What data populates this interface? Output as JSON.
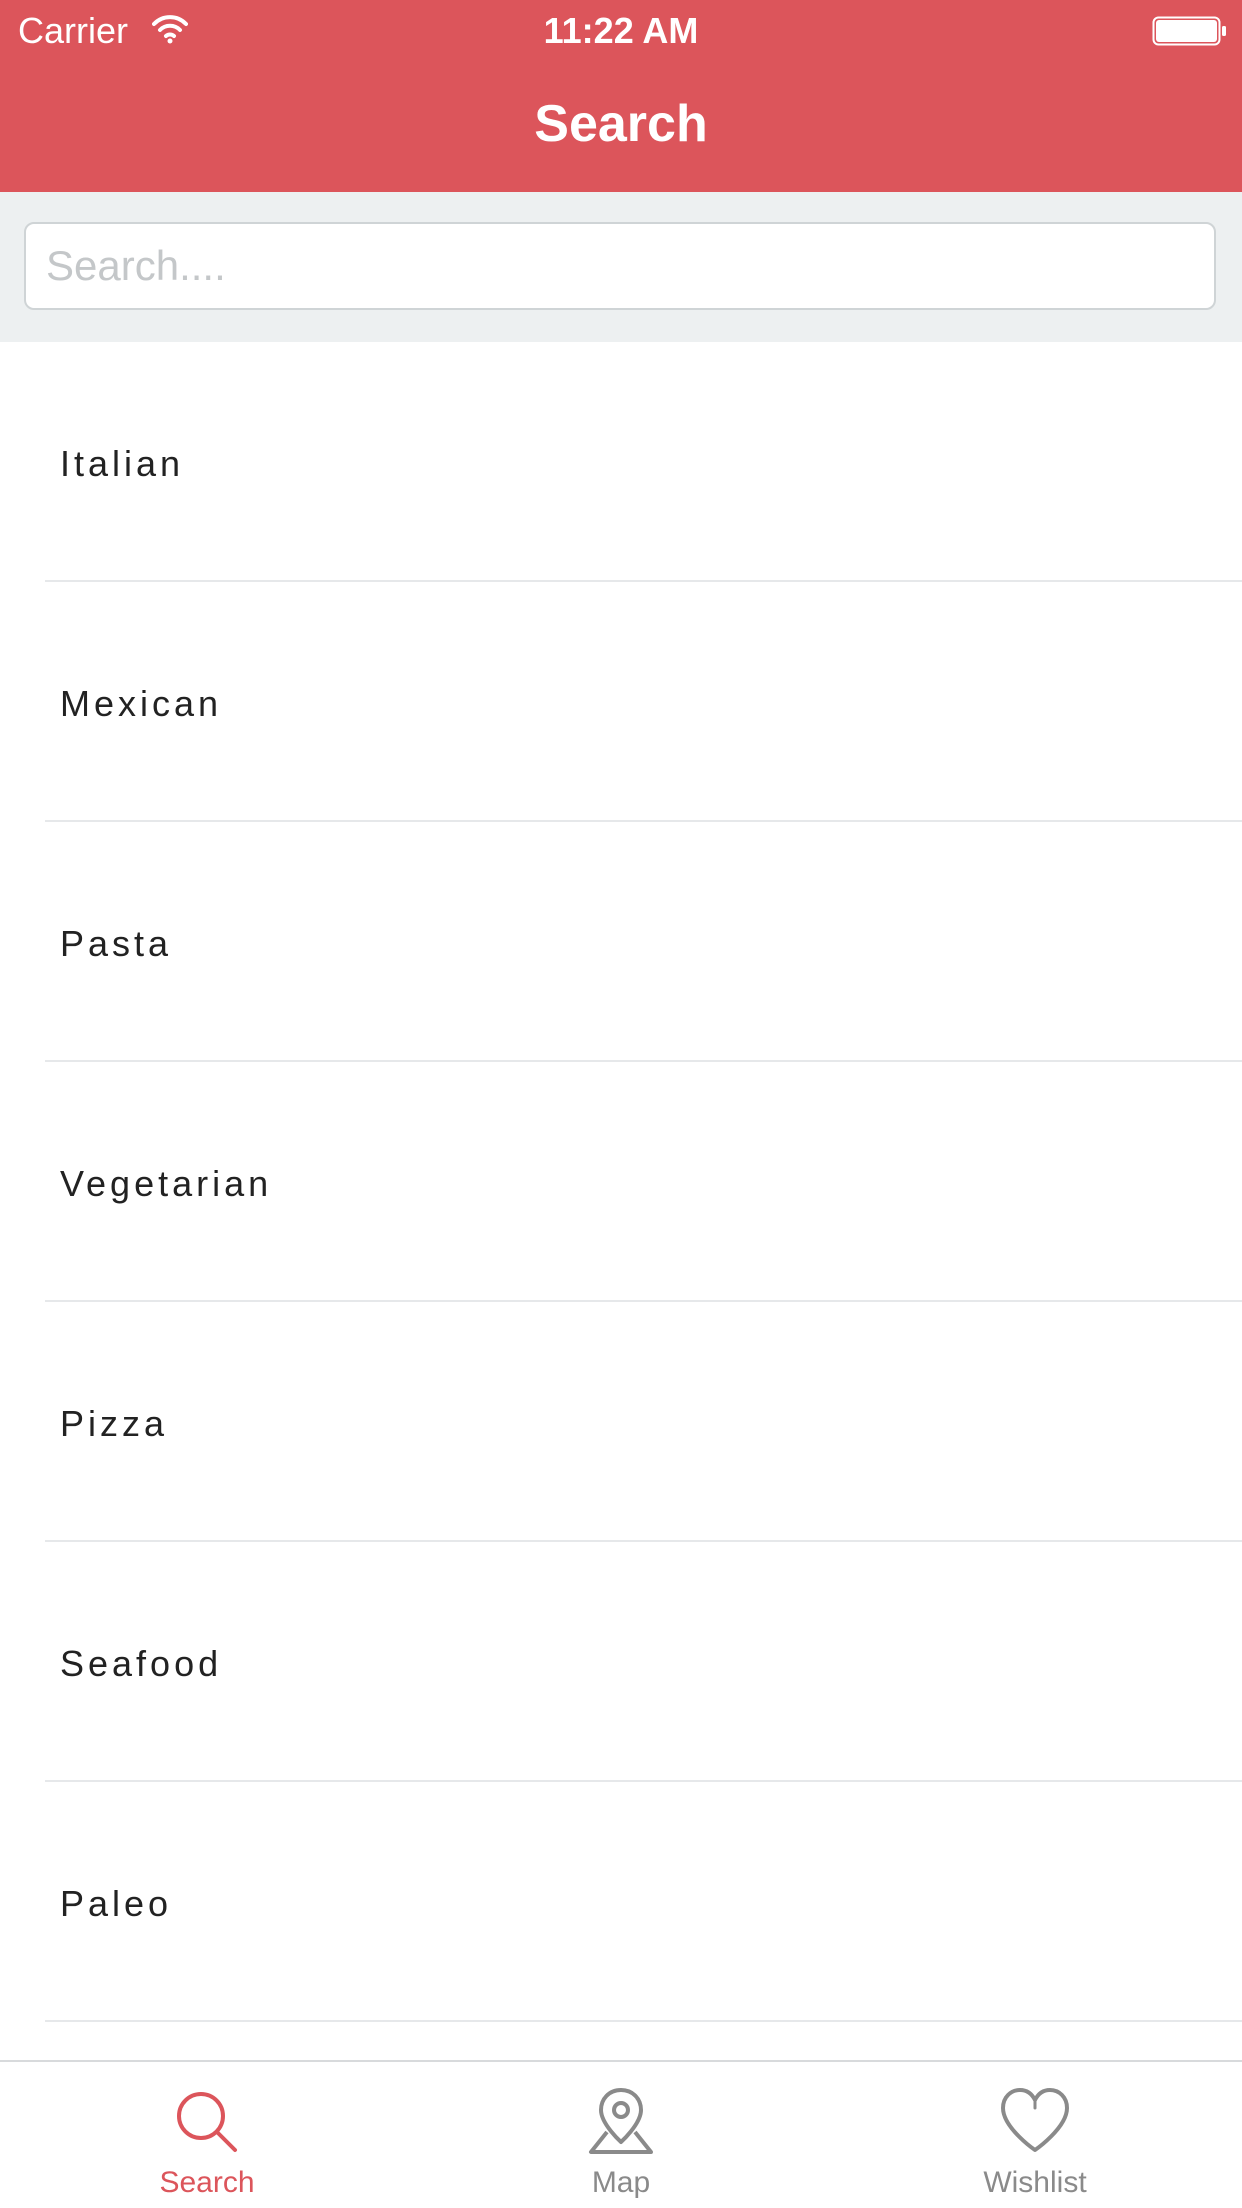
{
  "colors": {
    "accent": "#dc555b",
    "search_band": "#edf0f1",
    "inactive_tab": "#8a8a8a",
    "text": "#222222"
  },
  "status_bar": {
    "carrier": "Carrier",
    "time": "11:22 AM",
    "icons": [
      "wifi-icon",
      "battery-icon"
    ]
  },
  "nav": {
    "title": "Search"
  },
  "search": {
    "placeholder": "Search....",
    "value": ""
  },
  "list": {
    "items": [
      {
        "label": "Italian"
      },
      {
        "label": "Mexican"
      },
      {
        "label": "Pasta"
      },
      {
        "label": "Vegetarian"
      },
      {
        "label": "Pizza"
      },
      {
        "label": "Seafood"
      },
      {
        "label": "Paleo"
      }
    ]
  },
  "tabs": [
    {
      "label": "Search",
      "icon": "search-icon",
      "active": true
    },
    {
      "label": "Map",
      "icon": "map-pin-icon",
      "active": false
    },
    {
      "label": "Wishlist",
      "icon": "heart-icon",
      "active": false
    }
  ]
}
